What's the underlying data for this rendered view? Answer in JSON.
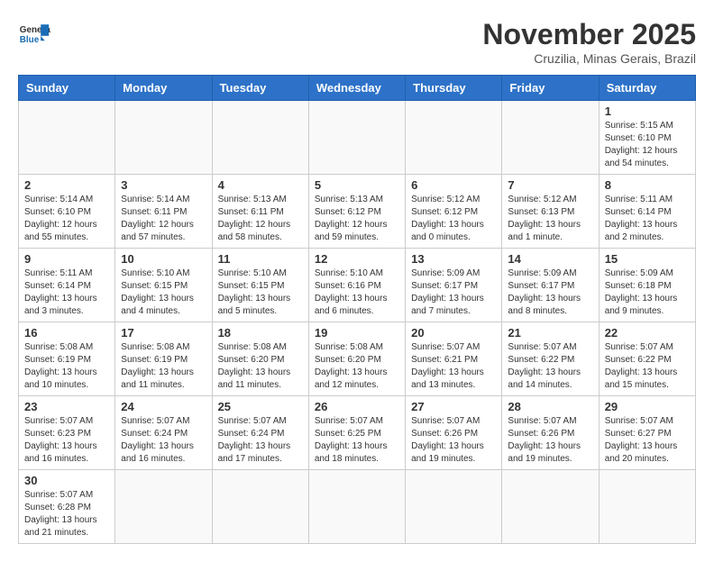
{
  "header": {
    "logo_general": "General",
    "logo_blue": "Blue",
    "month_title": "November 2025",
    "location": "Cruzilia, Minas Gerais, Brazil"
  },
  "weekdays": [
    "Sunday",
    "Monday",
    "Tuesday",
    "Wednesday",
    "Thursday",
    "Friday",
    "Saturday"
  ],
  "weeks": [
    [
      {
        "day": "",
        "info": ""
      },
      {
        "day": "",
        "info": ""
      },
      {
        "day": "",
        "info": ""
      },
      {
        "day": "",
        "info": ""
      },
      {
        "day": "",
        "info": ""
      },
      {
        "day": "",
        "info": ""
      },
      {
        "day": "1",
        "info": "Sunrise: 5:15 AM\nSunset: 6:10 PM\nDaylight: 12 hours and 54 minutes."
      }
    ],
    [
      {
        "day": "2",
        "info": "Sunrise: 5:14 AM\nSunset: 6:10 PM\nDaylight: 12 hours and 55 minutes."
      },
      {
        "day": "3",
        "info": "Sunrise: 5:14 AM\nSunset: 6:11 PM\nDaylight: 12 hours and 57 minutes."
      },
      {
        "day": "4",
        "info": "Sunrise: 5:13 AM\nSunset: 6:11 PM\nDaylight: 12 hours and 58 minutes."
      },
      {
        "day": "5",
        "info": "Sunrise: 5:13 AM\nSunset: 6:12 PM\nDaylight: 12 hours and 59 minutes."
      },
      {
        "day": "6",
        "info": "Sunrise: 5:12 AM\nSunset: 6:12 PM\nDaylight: 13 hours and 0 minutes."
      },
      {
        "day": "7",
        "info": "Sunrise: 5:12 AM\nSunset: 6:13 PM\nDaylight: 13 hours and 1 minute."
      },
      {
        "day": "8",
        "info": "Sunrise: 5:11 AM\nSunset: 6:14 PM\nDaylight: 13 hours and 2 minutes."
      }
    ],
    [
      {
        "day": "9",
        "info": "Sunrise: 5:11 AM\nSunset: 6:14 PM\nDaylight: 13 hours and 3 minutes."
      },
      {
        "day": "10",
        "info": "Sunrise: 5:10 AM\nSunset: 6:15 PM\nDaylight: 13 hours and 4 minutes."
      },
      {
        "day": "11",
        "info": "Sunrise: 5:10 AM\nSunset: 6:15 PM\nDaylight: 13 hours and 5 minutes."
      },
      {
        "day": "12",
        "info": "Sunrise: 5:10 AM\nSunset: 6:16 PM\nDaylight: 13 hours and 6 minutes."
      },
      {
        "day": "13",
        "info": "Sunrise: 5:09 AM\nSunset: 6:17 PM\nDaylight: 13 hours and 7 minutes."
      },
      {
        "day": "14",
        "info": "Sunrise: 5:09 AM\nSunset: 6:17 PM\nDaylight: 13 hours and 8 minutes."
      },
      {
        "day": "15",
        "info": "Sunrise: 5:09 AM\nSunset: 6:18 PM\nDaylight: 13 hours and 9 minutes."
      }
    ],
    [
      {
        "day": "16",
        "info": "Sunrise: 5:08 AM\nSunset: 6:19 PM\nDaylight: 13 hours and 10 minutes."
      },
      {
        "day": "17",
        "info": "Sunrise: 5:08 AM\nSunset: 6:19 PM\nDaylight: 13 hours and 11 minutes."
      },
      {
        "day": "18",
        "info": "Sunrise: 5:08 AM\nSunset: 6:20 PM\nDaylight: 13 hours and 11 minutes."
      },
      {
        "day": "19",
        "info": "Sunrise: 5:08 AM\nSunset: 6:20 PM\nDaylight: 13 hours and 12 minutes."
      },
      {
        "day": "20",
        "info": "Sunrise: 5:07 AM\nSunset: 6:21 PM\nDaylight: 13 hours and 13 minutes."
      },
      {
        "day": "21",
        "info": "Sunrise: 5:07 AM\nSunset: 6:22 PM\nDaylight: 13 hours and 14 minutes."
      },
      {
        "day": "22",
        "info": "Sunrise: 5:07 AM\nSunset: 6:22 PM\nDaylight: 13 hours and 15 minutes."
      }
    ],
    [
      {
        "day": "23",
        "info": "Sunrise: 5:07 AM\nSunset: 6:23 PM\nDaylight: 13 hours and 16 minutes."
      },
      {
        "day": "24",
        "info": "Sunrise: 5:07 AM\nSunset: 6:24 PM\nDaylight: 13 hours and 16 minutes."
      },
      {
        "day": "25",
        "info": "Sunrise: 5:07 AM\nSunset: 6:24 PM\nDaylight: 13 hours and 17 minutes."
      },
      {
        "day": "26",
        "info": "Sunrise: 5:07 AM\nSunset: 6:25 PM\nDaylight: 13 hours and 18 minutes."
      },
      {
        "day": "27",
        "info": "Sunrise: 5:07 AM\nSunset: 6:26 PM\nDaylight: 13 hours and 19 minutes."
      },
      {
        "day": "28",
        "info": "Sunrise: 5:07 AM\nSunset: 6:26 PM\nDaylight: 13 hours and 19 minutes."
      },
      {
        "day": "29",
        "info": "Sunrise: 5:07 AM\nSunset: 6:27 PM\nDaylight: 13 hours and 20 minutes."
      }
    ],
    [
      {
        "day": "30",
        "info": "Sunrise: 5:07 AM\nSunset: 6:28 PM\nDaylight: 13 hours and 21 minutes."
      },
      {
        "day": "",
        "info": ""
      },
      {
        "day": "",
        "info": ""
      },
      {
        "day": "",
        "info": ""
      },
      {
        "day": "",
        "info": ""
      },
      {
        "day": "",
        "info": ""
      },
      {
        "day": "",
        "info": ""
      }
    ]
  ]
}
